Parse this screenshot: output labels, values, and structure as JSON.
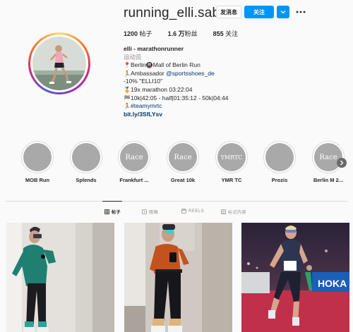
{
  "profile": {
    "username": "running_elli.sabeth",
    "message_label": "发消息",
    "follow_label": "关注",
    "stats": [
      {
        "num": "1200",
        "label": "帖子"
      },
      {
        "num": "1.6 万",
        "label": "粉丝"
      },
      {
        "num": "855",
        "label": "关注"
      }
    ]
  },
  "bio": {
    "name": "elli - marathonrunner",
    "category": "运动员",
    "lines": [
      {
        "emoji": "📍",
        "text": "Berlin",
        "emoji2": "🚇",
        "text2": "Mall of Berlin Run"
      },
      {
        "emoji": "🏃",
        "text": "Ambassador ",
        "mention": "@sportsshoes_de"
      },
      {
        "text": "-10% \"ELLI10\""
      },
      {
        "emoji": "🏅",
        "text": "19x marathon 03:22:04"
      },
      {
        "emoji": "🏁",
        "text": "10k|42:05 - half|01:35:12 - 50k|04:44"
      },
      {
        "emoji": "🏃",
        "hashtag": "#teamymrtc"
      }
    ],
    "link": "bit.ly/3SfLYsv"
  },
  "highlights": [
    {
      "label": "MOB Run",
      "cover": ""
    },
    {
      "label": "Splends",
      "cover": ""
    },
    {
      "label": "Frankfurt ...",
      "cover": "Race"
    },
    {
      "label": "Great 10k",
      "cover": "Race"
    },
    {
      "label": "YMR TC",
      "cover": "YMRTC"
    },
    {
      "label": "Prozis",
      "cover": ""
    },
    {
      "label": "Berlin M 2...",
      "cover": "Race"
    }
  ],
  "tabs": [
    {
      "label": "帖子",
      "icon": "grid-icon",
      "active": true
    },
    {
      "label": "随稿",
      "icon": "reels-clip-icon",
      "active": false
    },
    {
      "label": "REELS",
      "icon": "reels-icon",
      "active": false
    },
    {
      "label": "标记内容",
      "icon": "tag-icon",
      "active": false
    }
  ],
  "post_overlays": {
    "hoka_text": "HOKA"
  },
  "colors": {
    "accent": "#0095f6",
    "link": "#00376b"
  }
}
